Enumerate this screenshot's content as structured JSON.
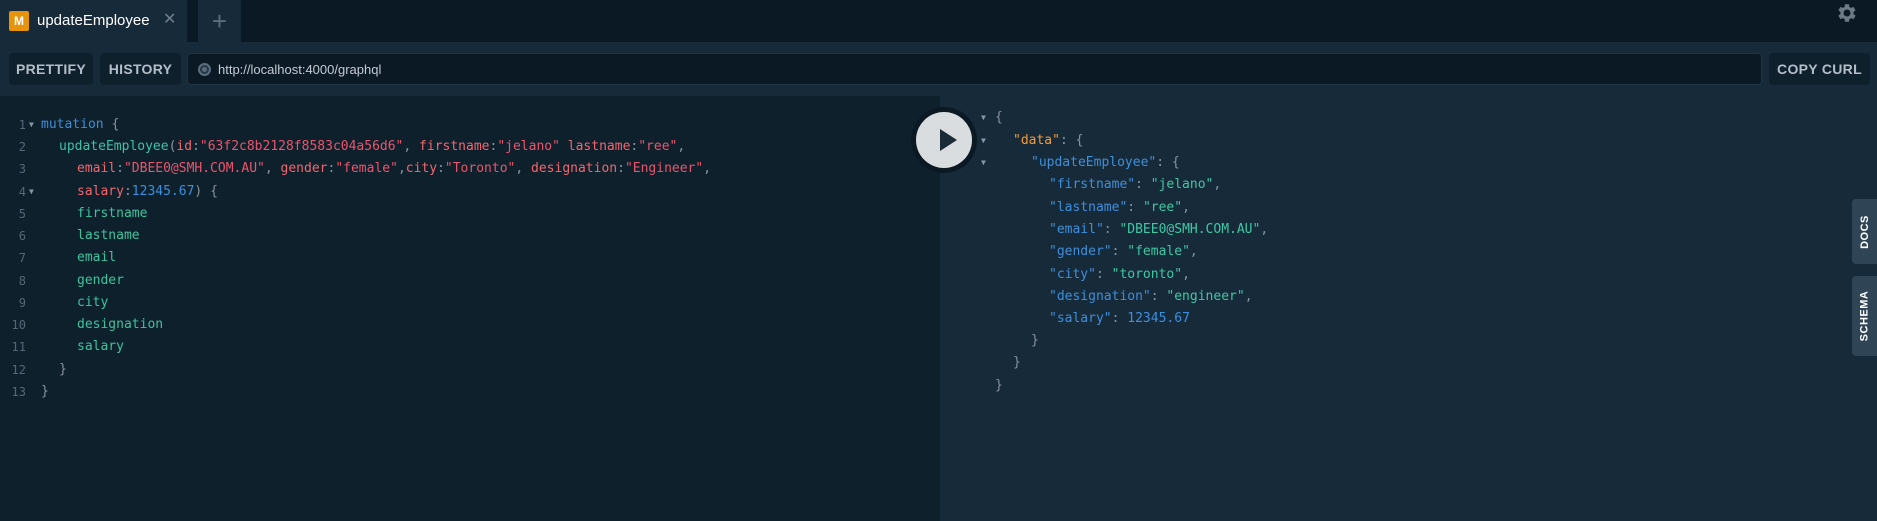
{
  "tabs": [
    {
      "badge": "M",
      "title": "updateEmployee",
      "close": "✕"
    }
  ],
  "tab_add": "+",
  "toolbar": {
    "prettify": "PRETTIFY",
    "history": "HISTORY",
    "url": "http://localhost:4000/graphql",
    "copy_curl": "COPY CURL"
  },
  "side_tabs": {
    "docs": "DOCS",
    "schema": "SCHEMA"
  },
  "query": {
    "line_numbers": [
      "1",
      "2",
      "3",
      "4",
      "5",
      "6",
      "7",
      "8",
      "9",
      "10",
      "11",
      "12",
      "13"
    ],
    "mutation_kw": "mutation",
    "mutation_name": "updateEmployee",
    "args": {
      "id": "\"63f2c8b2128f8583c04a56d6\"",
      "firstname": "\"jelano\"",
      "lastname": "\"ree\"",
      "email": "\"DBEE0@SMH.COM.AU\"",
      "gender": "\"female\"",
      "city": "\"Toronto\"",
      "designation": "\"Engineer\"",
      "salary": "12345.67"
    },
    "fields": [
      "firstname",
      "lastname",
      "email",
      "gender",
      "city",
      "designation",
      "salary"
    ]
  },
  "result": {
    "data_key": "\"data\"",
    "mutation_key": "\"updateEmployee\"",
    "entries": [
      {
        "key": "\"firstname\"",
        "value": "\"jelano\"",
        "type": "string"
      },
      {
        "key": "\"lastname\"",
        "value": "\"ree\"",
        "type": "string"
      },
      {
        "key": "\"email\"",
        "value": "\"DBEE0@SMH.COM.AU\"",
        "type": "string"
      },
      {
        "key": "\"gender\"",
        "value": "\"female\"",
        "type": "string"
      },
      {
        "key": "\"city\"",
        "value": "\"toronto\"",
        "type": "string"
      },
      {
        "key": "\"designation\"",
        "value": "\"engineer\"",
        "type": "string"
      },
      {
        "key": "\"salary\"",
        "value": "12345.67",
        "type": "number"
      }
    ]
  }
}
